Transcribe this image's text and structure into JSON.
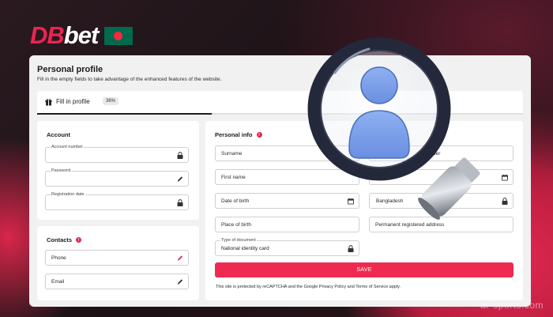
{
  "brand": {
    "logo_part1": "DB",
    "logo_part2": "bet",
    "flag_icon": "bangladesh-flag-icon"
  },
  "profile": {
    "title": "Personal profile",
    "subtitle": "Fill in the empty fields to take advantage of the enhanced features of the website.",
    "tab": {
      "label": "Fill in profile",
      "badge": "36%",
      "progress": 0.36
    }
  },
  "account": {
    "title": "Account",
    "fields": [
      {
        "label": "Account number",
        "icon": "lock-icon"
      },
      {
        "label": "Password",
        "icon": "pencil-icon"
      },
      {
        "label": "Registration date",
        "icon": "lock-icon"
      }
    ]
  },
  "contacts": {
    "title": "Contacts",
    "fields": [
      {
        "placeholder": "Phone",
        "icon": "pencil-icon",
        "icon_color": "#e8264f"
      },
      {
        "placeholder": "Email",
        "icon": "pencil-icon"
      }
    ]
  },
  "personal_info": {
    "title": "Personal info",
    "surname": "Surname",
    "first_name": "First name",
    "dob": "Date of birth",
    "place_of_birth": "Place of birth",
    "doc_type_label": "Type of document",
    "doc_type_value": "National identity card",
    "right_number_partial": "ber",
    "country_partial": "Bangladesh",
    "permanent_address": "Permanent registered address",
    "save": "SAVE",
    "recaptcha": "This site is protected by reCAPTCHA and the Google Privacy Policy and Terms of Service apply."
  },
  "colors": {
    "accent": "#ef2a51",
    "brand_red": "#e8264f",
    "panel_bg": "#f1f1f1"
  },
  "watermark": "ar-sports.com"
}
